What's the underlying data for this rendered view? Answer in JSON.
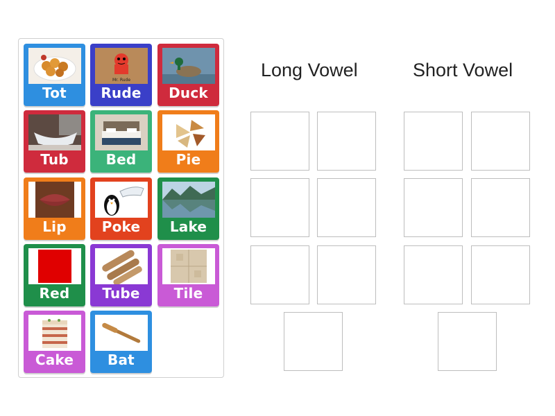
{
  "groups": [
    {
      "title": "Long Vowel"
    },
    {
      "title": "Short Vowel"
    }
  ],
  "cards": [
    {
      "label": "Tot",
      "color": "#2e8fe0",
      "image": "chicken-nuggets-image"
    },
    {
      "label": "Rude",
      "color": "#3a3fc8",
      "image": "mr-rude-image",
      "image_text": "Mr. Rude"
    },
    {
      "label": "Duck",
      "color": "#cf2b3d",
      "image": "duck-image"
    },
    {
      "label": "Tub",
      "color": "#cf2b3d",
      "image": "bathtub-image"
    },
    {
      "label": "Bed",
      "color": "#3bb37a",
      "image": "bed-image"
    },
    {
      "label": "Pie",
      "color": "#f07d1a",
      "image": "pie-slices-image"
    },
    {
      "label": "Lip",
      "color": "#f07d1a",
      "image": "lips-image"
    },
    {
      "label": "Poke",
      "color": "#e2421e",
      "image": "penguin-poke-image"
    },
    {
      "label": "Lake",
      "color": "#1f8f4a",
      "image": "lake-image"
    },
    {
      "label": "Red",
      "color": "#1f8f4a",
      "image": "red-square-image"
    },
    {
      "label": "Tube",
      "color": "#8a39d4",
      "image": "cardboard-tubes-image"
    },
    {
      "label": "Tile",
      "color": "#c95ad6",
      "image": "floor-tile-image"
    },
    {
      "label": "Cake",
      "color": "#c95ad6",
      "image": "layer-cake-image"
    },
    {
      "label": "Bat",
      "color": "#2e8fe0",
      "image": "baseball-bat-image"
    }
  ]
}
